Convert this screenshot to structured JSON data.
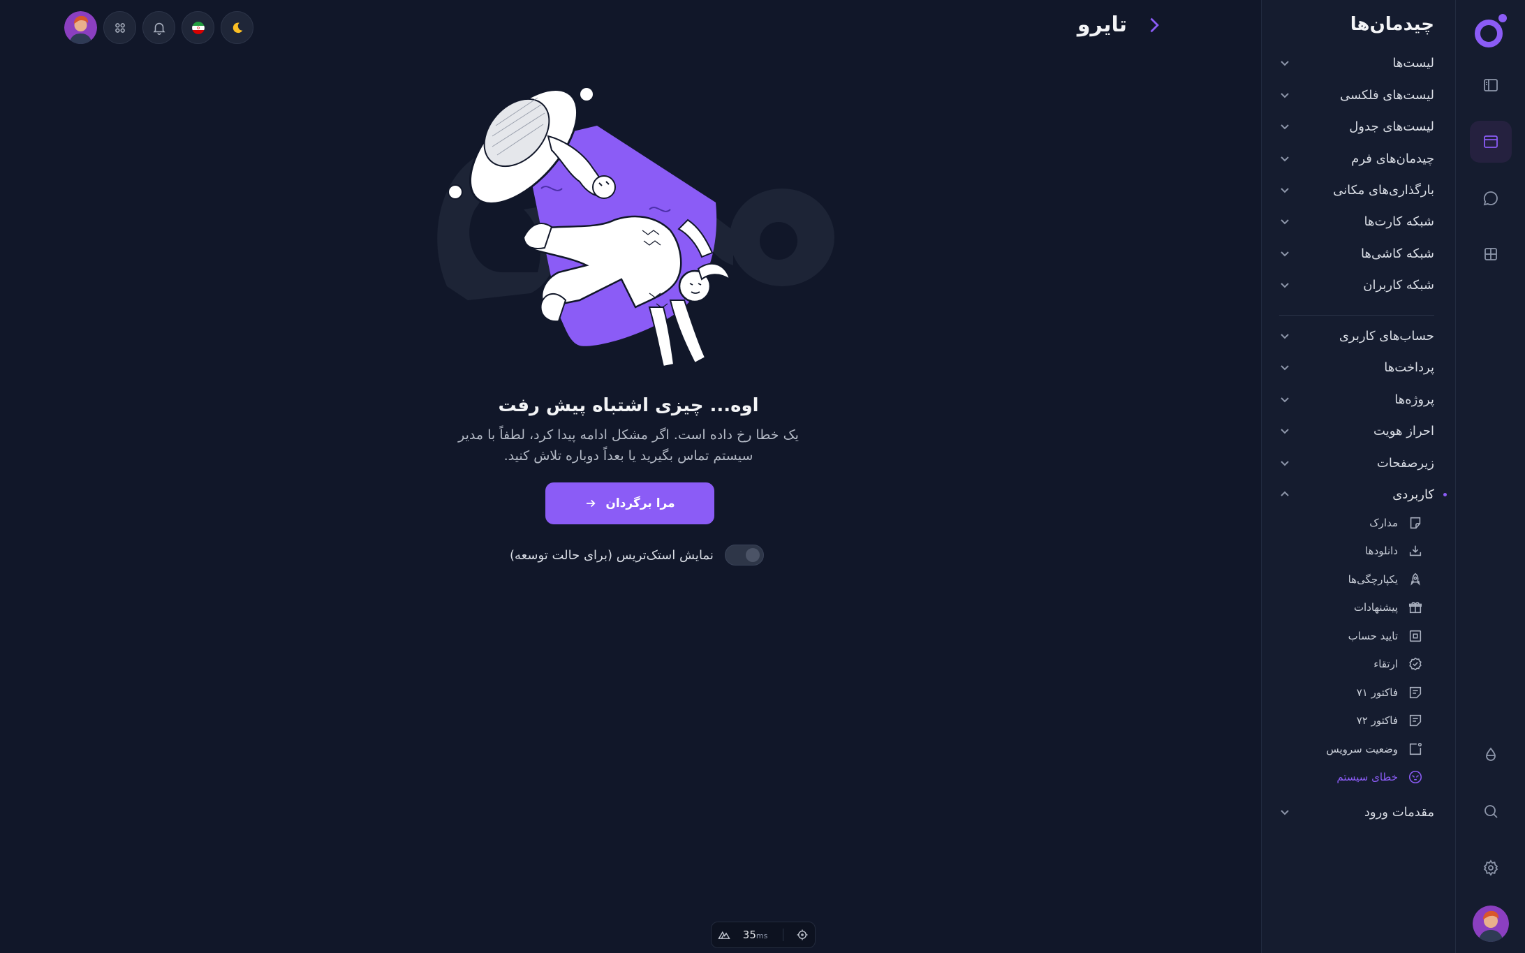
{
  "app": {
    "name": "تایرو"
  },
  "sidebar": {
    "title": "چیدمان‌ها",
    "items": [
      {
        "label": "لیست‌ها"
      },
      {
        "label": "لیست‌های فلکسی"
      },
      {
        "label": "لیست‌های جدول"
      },
      {
        "label": "چیدمان‌های فرم"
      },
      {
        "label": "بارگذاری‌های مکانی"
      },
      {
        "label": "شبکه کارت‌ها"
      },
      {
        "label": "شبکه کاشی‌ها"
      },
      {
        "label": "شبکه کاربران"
      },
      {
        "label": "حساب‌های کاربری"
      },
      {
        "label": "پرداخت‌ها"
      },
      {
        "label": "پروژه‌ها"
      },
      {
        "label": "احراز هویت"
      },
      {
        "label": "زیرصفحات"
      },
      {
        "label": "کاربردی"
      },
      {
        "label": "مقدمات ورود"
      }
    ],
    "sub_items": [
      {
        "label": "مدارک",
        "icon": "sticky-note-icon"
      },
      {
        "label": "دانلودها",
        "icon": "download-icon"
      },
      {
        "label": "یکپارچگی‌ها",
        "icon": "rocket-icon"
      },
      {
        "label": "پیشنهادات",
        "icon": "gift-icon"
      },
      {
        "label": "تایید حساب",
        "icon": "verify-box-icon"
      },
      {
        "label": "ارتقاء",
        "icon": "badge-check-icon"
      },
      {
        "label": "فاکتور ۷۱",
        "icon": "invoice-icon"
      },
      {
        "label": "فاکتور ۷۲",
        "icon": "invoice-icon"
      },
      {
        "label": "وضعیت سرویس",
        "icon": "status-icon"
      },
      {
        "label": "خطای سیستم",
        "icon": "alien-icon"
      }
    ]
  },
  "error": {
    "title": "اوه... چیزی اشتباه پیش رفت",
    "description": "یک خطا رخ داده است. اگر مشکل ادامه پیدا کرد، لطفاً با مدیر سیستم تماس بگیرید یا بعداً دوباره تلاش کنید.",
    "button_label": "مرا برگردان",
    "toggle_label": "نمایش استک‌تریس (برای حالت توسعه)",
    "toggle_on": false
  },
  "devbar": {
    "value": "35",
    "unit": "ms"
  },
  "colors": {
    "accent": "#8b5cf6",
    "background": "#111729",
    "panel": "#151c2f"
  }
}
